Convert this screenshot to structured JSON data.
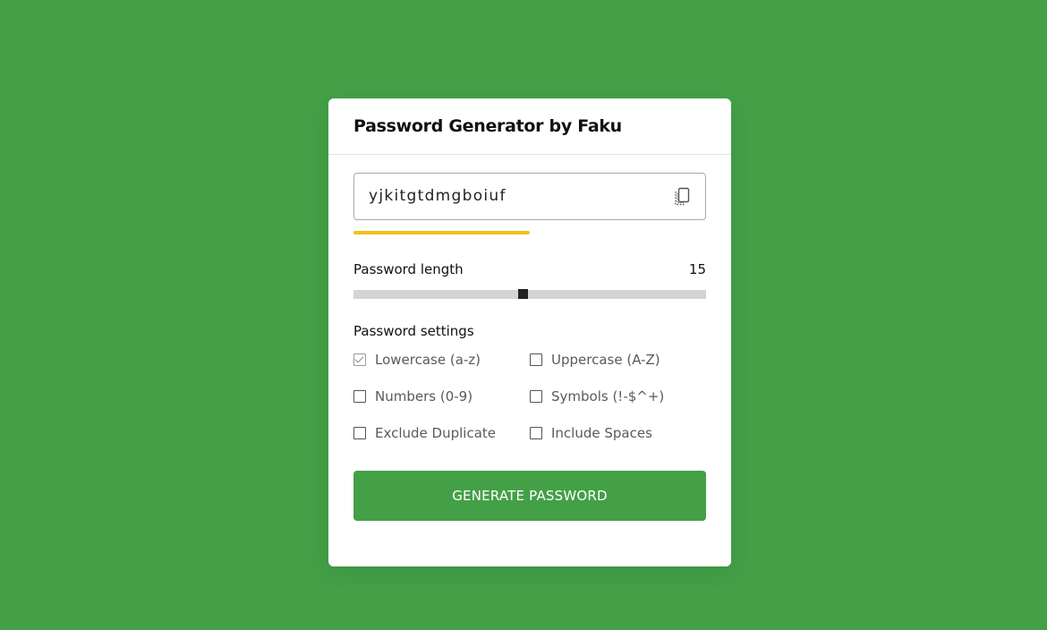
{
  "colors": {
    "background": "#43a047",
    "card": "#ffffff",
    "accent": "#43a047",
    "strength_indicator": "#f0c419",
    "slider_track": "#d4d4d4",
    "slider_thumb": "#222222"
  },
  "header": {
    "title": "Password Generator by Faku"
  },
  "password": {
    "value": "yjkitgtdmgboiuf",
    "copy_icon": "copy-icon",
    "strength_fraction": 0.5
  },
  "length": {
    "label": "Password length",
    "value": "15",
    "slider_fraction": 0.48
  },
  "settings": {
    "label": "Password settings",
    "options": [
      {
        "label": "Lowercase (a-z)",
        "checked": true
      },
      {
        "label": "Uppercase (A-Z)",
        "checked": false
      },
      {
        "label": "Numbers (0-9)",
        "checked": false
      },
      {
        "label": "Symbols (!-$^+)",
        "checked": false
      },
      {
        "label": "Exclude Duplicate",
        "checked": false
      },
      {
        "label": "Include Spaces",
        "checked": false
      }
    ]
  },
  "generate_button": {
    "label": "GENERATE PASSWORD"
  }
}
